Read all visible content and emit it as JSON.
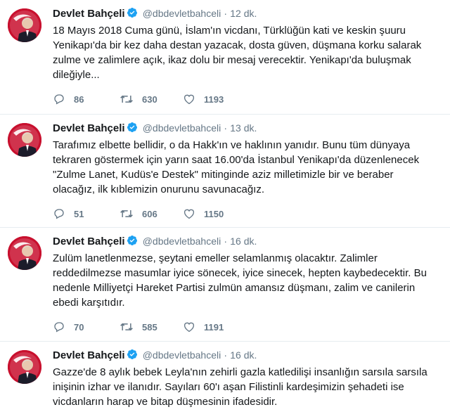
{
  "tweets": [
    {
      "name": "Devlet Bahçeli",
      "handle": "@dbdevletbahceli",
      "separator": "·",
      "time": "12 dk.",
      "text": "18 Mayıs 2018 Cuma günü, İslam'ın vicdanı, Türklüğün kati ve keskin şuuru Yenikapı'da bir kez daha destan yazacak, dosta güven, düşmana korku salarak zulme ve zalimlere açık, ikaz dolu bir mesaj verecektir. Yenikapı'da buluşmak dileğiyle...",
      "replies": "86",
      "retweets": "630",
      "likes": "1193"
    },
    {
      "name": "Devlet Bahçeli",
      "handle": "@dbdevletbahceli",
      "separator": "·",
      "time": "13 dk.",
      "text": "Tarafımız elbette bellidir, o da Hakk'ın ve haklının yanıdır. Bunu tüm dünyaya tekraren göstermek için yarın saat 16.00'da İstanbul Yenikapı'da düzenlenecek \"Zulme Lanet, Kudüs'e Destek\" mitinginde aziz milletimizle bir ve beraber olacağız, ilk kıblemizin onurunu savunacağız.",
      "replies": "51",
      "retweets": "606",
      "likes": "1150"
    },
    {
      "name": "Devlet Bahçeli",
      "handle": "@dbdevletbahceli",
      "separator": "·",
      "time": "16 dk.",
      "text": "Zulüm lanetlenmezse, şeytani emeller selamlanmış olacaktır. Zalimler reddedilmezse masumlar iyice sönecek, iyice sinecek, hepten kaybedecektir. Bu nedenle Milliyetçi Hareket Partisi zulmün amansız düşmanı, zalim ve canilerin ebedi karşıtıdır.",
      "replies": "70",
      "retweets": "585",
      "likes": "1191"
    },
    {
      "name": "Devlet Bahçeli",
      "handle": "@dbdevletbahceli",
      "separator": "·",
      "time": "16 dk.",
      "text": "Gazze'de 8 aylık bebek Leyla'nın zehirli gazla katledilişi insanlığın sarsıla sarsıla inişinin izhar ve ilanıdır. Sayıları 60'ı aşan Filistinli kardeşimizin şehadeti ise vicdanların harap ve bitap düşmesinin ifadesidir.",
      "replies": "",
      "retweets": "",
      "likes": ""
    }
  ],
  "colors": {
    "verified": "#1da1f2",
    "meta": "#657786",
    "text": "#14171a",
    "avatar_bg": "#c8102e"
  },
  "icons": [
    "avatar",
    "verified-badge-icon",
    "reply-icon",
    "retweet-icon",
    "like-icon"
  ]
}
